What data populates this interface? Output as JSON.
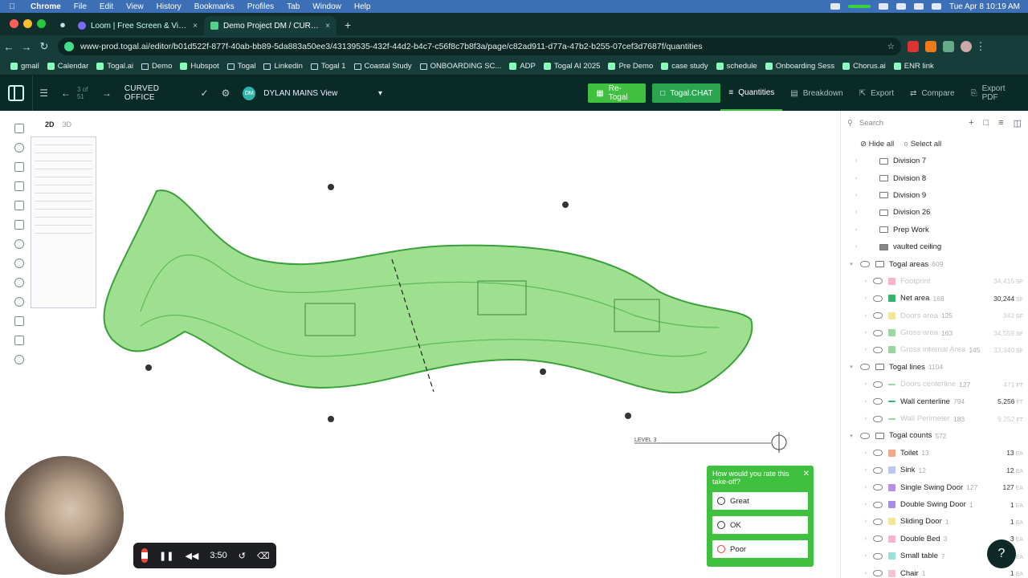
{
  "menubar": {
    "app": "Chrome",
    "items": [
      "File",
      "Edit",
      "View",
      "History",
      "Bookmarks",
      "Profiles",
      "Tab",
      "Window",
      "Help"
    ],
    "clock": "Tue Apr 8  10:19 AM"
  },
  "tabs": [
    {
      "title": "Loom | Free Screen & Video R",
      "active": false
    },
    {
      "title": "Demo Project DM / CURVED",
      "active": true
    }
  ],
  "address": {
    "url": "www-prod.togal.ai/editor/b01d522f-877f-40ab-bb89-5da883a50ee3/43139535-432f-44d2-b4c7-c56f8c7b8f3a/page/c82ad911-d77a-47b2-b255-07cef3d7687f/quantities"
  },
  "bookmarks": [
    "gmail",
    "Calendar",
    "Togal.ai",
    "Demo",
    "Hubspot",
    "Togal",
    "Linkedin",
    "Togal 1",
    "Coastal Study",
    "ONBOARDING SC...",
    "ADP",
    "Togal AI 2025",
    "Pre Demo",
    "case study",
    "schedule",
    "Onboarding Sess",
    "Chorus.ai",
    "ENR link"
  ],
  "app": {
    "pager": "3 of 51",
    "project": "CURVED OFFICE",
    "user_initials": "DM",
    "view": "DYLAN MAINS View",
    "retogal": "Re-Togal",
    "chat": "Togal.CHAT",
    "nav": [
      "Quantities",
      "Breakdown",
      "Export",
      "Compare",
      "Export PDF"
    ]
  },
  "canvas": {
    "view_2d": "2D",
    "view_3d": "3D",
    "level_label": "LEVEL 3"
  },
  "panel": {
    "search_placeholder": "Search",
    "hide_all": "Hide all",
    "select_all": "Select all",
    "rows": [
      {
        "label": "Division 7",
        "indent": 1,
        "type": "folder"
      },
      {
        "label": "Division 8",
        "indent": 1,
        "type": "folder"
      },
      {
        "label": "Division 9",
        "indent": 1,
        "type": "folder"
      },
      {
        "label": "Division 26",
        "indent": 1,
        "type": "folder"
      },
      {
        "label": "Prep Work",
        "indent": 1,
        "type": "folder"
      },
      {
        "label": "vaulted ceiling",
        "indent": 1,
        "type": "hatch"
      },
      {
        "label": "Togal areas",
        "count": "609",
        "indent": 0,
        "type": "group"
      },
      {
        "label": "Footprint",
        "count": "",
        "value": "34,415",
        "unit": "SF",
        "dim": true,
        "color": "#f6b6c8"
      },
      {
        "label": "Net area",
        "count": "168",
        "value": "30,244",
        "unit": "SF",
        "color": "#36b36a"
      },
      {
        "label": "Doors area",
        "count": "125",
        "value": "342",
        "unit": "SF",
        "dim": true,
        "color": "#f3e79a"
      },
      {
        "label": "Gross area",
        "count": "163",
        "value": "34,559",
        "unit": "SF",
        "dim": true,
        "color": "#9bd6a3"
      },
      {
        "label": "Gross internal Area",
        "count": "145",
        "value": "33,340",
        "unit": "SF",
        "dim": true,
        "color": "#9bd6a3"
      },
      {
        "label": "Togal lines",
        "count": "1104",
        "indent": 0,
        "type": "group"
      },
      {
        "label": "Doors centerline",
        "count": "127",
        "value": "471",
        "unit": "FT",
        "dim": true,
        "color": "#9bd6a3",
        "line": true
      },
      {
        "label": "Wall centerline",
        "count": "794",
        "value": "5,256",
        "unit": "FT",
        "color": "#36b36a",
        "line": true
      },
      {
        "label": "Wall Perimeter",
        "count": "183",
        "value": "9,252",
        "unit": "FT",
        "dim": true,
        "color": "#9bd6a3",
        "line": true
      },
      {
        "label": "Togal counts",
        "count": "572",
        "indent": 0,
        "type": "group"
      },
      {
        "label": "Toilet",
        "count": "13",
        "value": "13",
        "unit": "EA",
        "color": "#f4a98b"
      },
      {
        "label": "Sink",
        "count": "12",
        "value": "12",
        "unit": "EA",
        "color": "#b9c7f2"
      },
      {
        "label": "Single Swing Door",
        "count": "127",
        "value": "127",
        "unit": "EA",
        "color": "#b690e8"
      },
      {
        "label": "Double Swing Door",
        "count": "1",
        "value": "1",
        "unit": "EA",
        "color": "#a58fe6"
      },
      {
        "label": "Sliding Door",
        "count": "1",
        "value": "1",
        "unit": "EA",
        "color": "#f3e79a"
      },
      {
        "label": "Double Bed",
        "count": "3",
        "value": "3",
        "unit": "EA",
        "color": "#f6b6c8"
      },
      {
        "label": "Small table",
        "count": "7",
        "value": "7",
        "unit": "EA",
        "color": "#9fe0d6"
      },
      {
        "label": "Chair",
        "count": "1",
        "value": "1",
        "unit": "EA",
        "color": "#f3c4d6"
      }
    ]
  },
  "recorder": {
    "time": "3:50"
  },
  "rating": {
    "question": "How would you rate this take-off?",
    "options": [
      "Great",
      "OK",
      "Poor"
    ]
  },
  "help": "?",
  "colors": {
    "accent": "#3fc13f",
    "toolbar": "#0a2a28",
    "room_fill": "#9ee08f"
  }
}
